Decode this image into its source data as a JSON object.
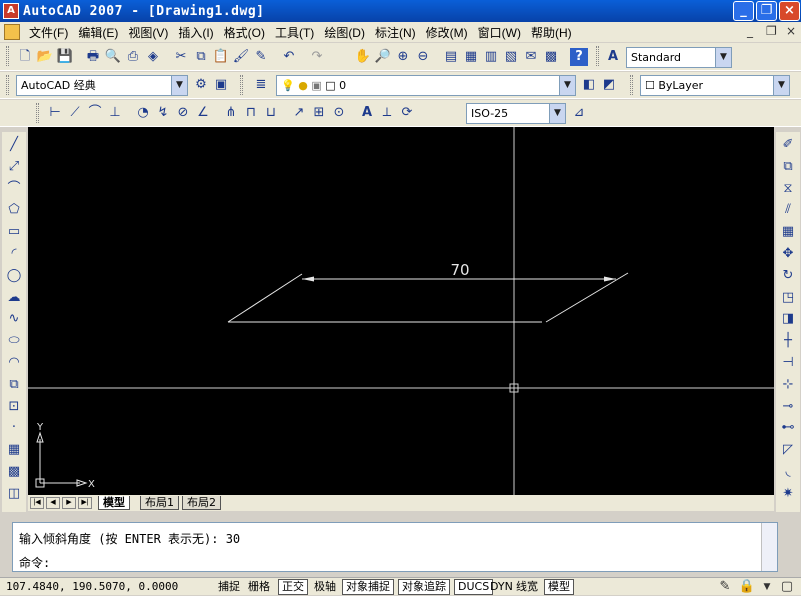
{
  "window": {
    "title": "AutoCAD 2007 - [Drawing1.dwg]",
    "min_glyph": "_",
    "restore_glyph": "❐",
    "close_glyph": "×",
    "doc_min_glyph": "_",
    "doc_restore_glyph": "❐",
    "doc_close_glyph": "×"
  },
  "menu": {
    "items": [
      "文件(F)",
      "编辑(E)",
      "视图(V)",
      "插入(I)",
      "格式(O)",
      "工具(T)",
      "绘图(D)",
      "标注(N)",
      "修改(M)",
      "窗口(W)",
      "帮助(H)"
    ]
  },
  "toolbar1": {
    "icons": [
      "new-icon",
      "open-icon",
      "save-icon",
      "print-icon",
      "preview-icon",
      "publish-icon",
      "plot-3d-icon",
      "cut-icon",
      "copy-icon",
      "paste-icon",
      "match-properties-icon",
      "block-editor-icon",
      "undo-icon",
      "redo-icon",
      "pan-icon",
      "zoom-realtime-icon",
      "zoom-window-icon",
      "zoom-previous-icon",
      "properties-icon",
      "design-center-icon",
      "tool-palettes-icon",
      "sheet-set-icon",
      "markup-icon",
      "calculator-icon",
      "help-icon"
    ],
    "text_style_icon": "text-style-icon",
    "text_style": "Standard"
  },
  "toolbar2": {
    "workspace": "AutoCAD 经典",
    "layer_value": "0",
    "color": "ByLayer"
  },
  "toolbar3": {
    "dim_style": "ISO-25"
  },
  "left_tools": [
    "line-icon",
    "construction-line-icon",
    "polyline-icon",
    "polygon-icon",
    "rectangle-icon",
    "arc-icon",
    "circle-icon",
    "revision-cloud-icon",
    "spline-icon",
    "ellipse-icon",
    "ellipse-arc-icon",
    "insert-block-icon",
    "make-block-icon",
    "point-icon",
    "hatch-icon",
    "gradient-icon",
    "region-icon"
  ],
  "right_tools": [
    "erase-icon",
    "copy-object-icon",
    "mirror-icon",
    "offset-icon",
    "array-icon",
    "move-icon",
    "rotate-icon",
    "scale-icon",
    "stretch-icon",
    "trim-icon",
    "extend-icon",
    "break-at-point-icon",
    "break-icon",
    "join-icon",
    "chamfer-icon",
    "fillet-icon",
    "explode-icon"
  ],
  "drawing": {
    "dimension_text": "70",
    "ucs_x": "X",
    "ucs_y": "Y",
    "colors": {
      "background": "#000000",
      "lines": "#e6e6e6",
      "crosshair": "#d0d0d0"
    }
  },
  "tabs": {
    "nav": [
      "|◀",
      "◀",
      "▶",
      "▶|"
    ],
    "items": [
      "模型",
      "布局1",
      "布局2"
    ],
    "active": "模型"
  },
  "command": {
    "history_line": "输入倾斜角度 (按 ENTER 表示无): 30",
    "prompt": "命令:"
  },
  "status": {
    "coordinates": "107.4840, 190.5070, 0.0000",
    "buttons": [
      "捕捉",
      "栅格",
      "正交",
      "极轴",
      "对象捕捉",
      "对象追踪",
      "DUCS",
      "DYN",
      "线宽",
      "模型"
    ],
    "on": [
      "正交",
      "对象捕捉",
      "对象追踪",
      "DUCS",
      "模型"
    ]
  }
}
